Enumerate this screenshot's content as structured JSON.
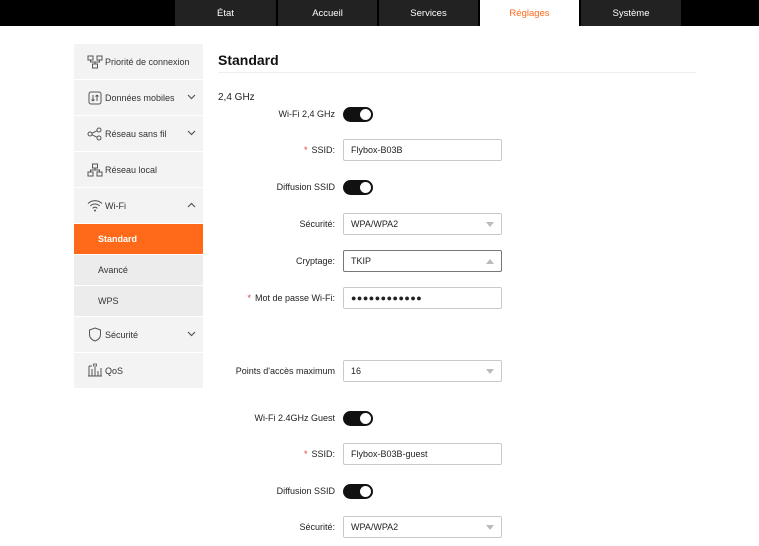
{
  "nav": {
    "tabs": [
      {
        "label": "État"
      },
      {
        "label": "Accueil"
      },
      {
        "label": "Services"
      },
      {
        "label": "Réglages"
      },
      {
        "label": "Système"
      }
    ],
    "active_color": "#ff6a1a"
  },
  "sidebar": {
    "items": [
      {
        "label": "Priorité de connexion",
        "icon": "network-priority-icon"
      },
      {
        "label": "Données mobiles",
        "icon": "mobile-data-icon"
      },
      {
        "label": "Réseau sans fil",
        "icon": "wireless-network-icon"
      },
      {
        "label": "Réseau local",
        "icon": "local-network-icon"
      },
      {
        "label": "Wi-Fi",
        "icon": "wifi-icon"
      },
      {
        "label": "Sécurité",
        "icon": "shield-icon"
      },
      {
        "label": "QoS",
        "icon": "qos-icon"
      }
    ],
    "wifi_sub": [
      {
        "label": "Standard"
      },
      {
        "label": "Avancé"
      },
      {
        "label": "WPS"
      }
    ]
  },
  "main": {
    "title": "Standard",
    "section": "2,4 GHz",
    "rows": {
      "wifi24_label": "Wi-Fi 2,4 GHz",
      "ssid_label": "SSID:",
      "ssid_value": "Flybox-B03B",
      "broadcast_label": "Diffusion SSID",
      "security_label": "Sécurité:",
      "security_value": "WPA/WPA2",
      "encryption_label": "Cryptage:",
      "encryption_value": "TKIP",
      "password_label": "Mot de passe Wi-Fi:",
      "password_value": "●●●●●●●●●●●●",
      "max_ap_label": "Points d'accès maximum",
      "max_ap_value": "16",
      "guest_label": "Wi-Fi 2.4GHz Guest",
      "guest_ssid_label": "SSID:",
      "guest_ssid_value": "Flybox-B03B-guest",
      "guest_broadcast_label": "Diffusion SSID",
      "guest_security_label": "Sécurité:",
      "guest_security_value": "WPA/WPA2",
      "required_mark": "*"
    }
  }
}
